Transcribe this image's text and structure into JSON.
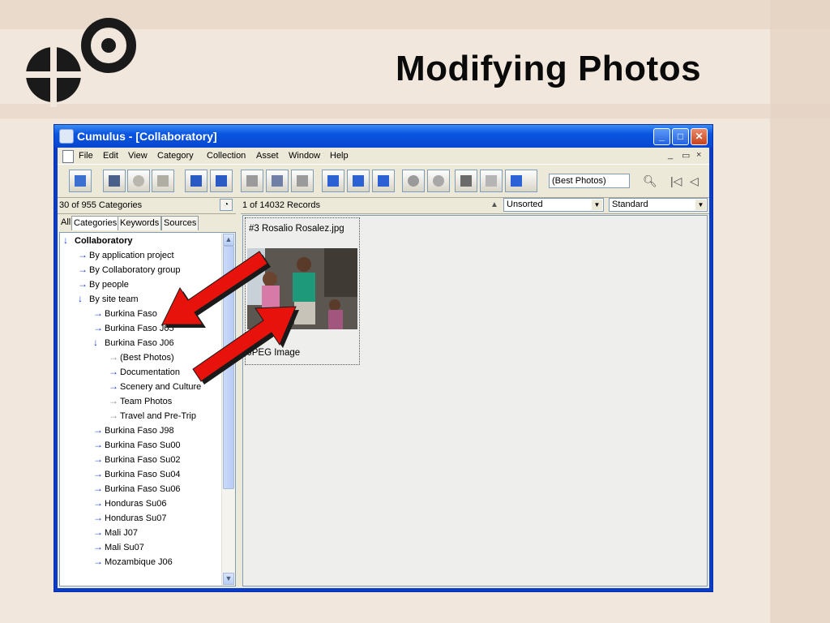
{
  "slide": {
    "title": "Modifying Photos"
  },
  "window": {
    "title": "Cumulus - [Collaboratory]",
    "buttons": {
      "minimize": "_",
      "maximize": "□",
      "close": "✕"
    }
  },
  "menubar": {
    "items": [
      "File",
      "Edit",
      "View",
      "Category",
      "Collection",
      "Asset",
      "Window",
      "Help"
    ],
    "mdi_controls": [
      "_",
      "▭",
      "×"
    ]
  },
  "toolbar": {
    "search_value": "(Best Photos)",
    "icons": [
      "sync-icon",
      "print-icon",
      "settings-icon",
      "trash-icon",
      "layout-1-icon",
      "layout-2-icon",
      "list-icon",
      "columns-icon",
      "details-icon",
      "small-thumb-icon",
      "medium-thumb-icon",
      "large-thumb-icon",
      "info-icon",
      "preview-icon",
      "filmstrip-icon",
      "send-icon",
      "find-icon"
    ]
  },
  "left_panel": {
    "count_label": "30 of 955 Categories",
    "tabs": [
      "All",
      "Categories",
      "Keywords",
      "Sources"
    ],
    "active_tab": "Categories",
    "tree": [
      {
        "label": "Collaboratory",
        "level": 0,
        "arrow": "down",
        "bold": true
      },
      {
        "label": "By application project",
        "level": 1,
        "arrow": "right"
      },
      {
        "label": "By Collaboratory group",
        "level": 1,
        "arrow": "right"
      },
      {
        "label": "By people",
        "level": 1,
        "arrow": "right"
      },
      {
        "label": "By site team",
        "level": 1,
        "arrow": "down"
      },
      {
        "label": "Burkina Faso",
        "level": 2,
        "arrow": "right"
      },
      {
        "label": "Burkina Faso J05",
        "level": 2,
        "arrow": "right"
      },
      {
        "label": "Burkina Faso J06",
        "level": 2,
        "arrow": "down"
      },
      {
        "label": "(Best Photos)",
        "level": 3,
        "arrow": "grey"
      },
      {
        "label": "Documentation",
        "level": 3,
        "arrow": "right"
      },
      {
        "label": "Scenery and Culture",
        "level": 3,
        "arrow": "right"
      },
      {
        "label": "Team Photos",
        "level": 3,
        "arrow": "grey"
      },
      {
        "label": "Travel and Pre-Trip",
        "level": 3,
        "arrow": "grey"
      },
      {
        "label": "Burkina Faso J98",
        "level": 2,
        "arrow": "right"
      },
      {
        "label": "Burkina Faso Su00",
        "level": 2,
        "arrow": "right"
      },
      {
        "label": "Burkina Faso Su02",
        "level": 2,
        "arrow": "right"
      },
      {
        "label": "Burkina Faso Su04",
        "level": 2,
        "arrow": "right"
      },
      {
        "label": "Burkina Faso Su06",
        "level": 2,
        "arrow": "right"
      },
      {
        "label": "Honduras Su06",
        "level": 2,
        "arrow": "right"
      },
      {
        "label": "Honduras Su07",
        "level": 2,
        "arrow": "right"
      },
      {
        "label": "Mali J07",
        "level": 2,
        "arrow": "right"
      },
      {
        "label": "Mali Su07",
        "level": 2,
        "arrow": "right"
      },
      {
        "label": "Mozambique J06",
        "level": 2,
        "arrow": "right"
      }
    ]
  },
  "right_panel": {
    "count_label": "1 of 14032 Records",
    "sort_value": "Unsorted",
    "view_value": "Standard",
    "records": [
      {
        "filename": "#3 Rosalio Rosalez.jpg",
        "type": "JPEG Image"
      }
    ]
  },
  "colors": {
    "titlebar": "#0a55e0",
    "annotation_arrow": "#e8120c",
    "tree_arrow": "#1d3fcc"
  }
}
